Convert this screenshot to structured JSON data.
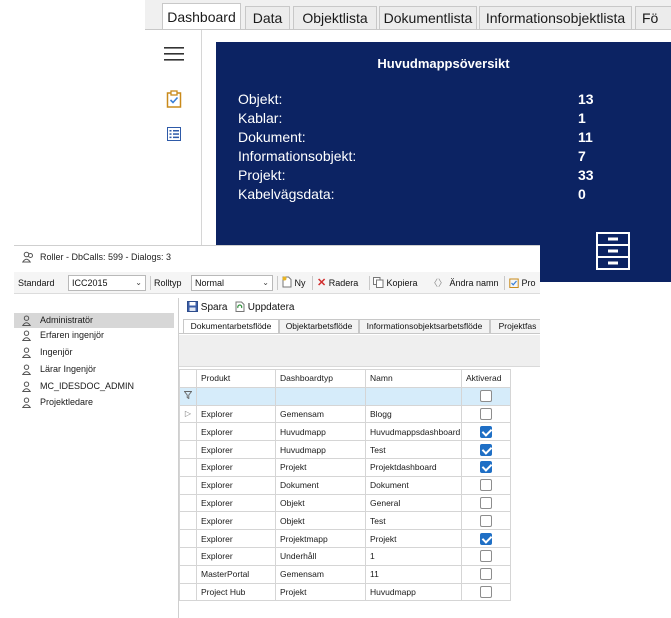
{
  "dashboard": {
    "tabs": [
      {
        "label": "Dashboard"
      },
      {
        "label": "Data"
      },
      {
        "label": "Objektlista"
      },
      {
        "label": "Dokumentlista"
      },
      {
        "label": "Informationsobjektlista"
      },
      {
        "label": "Fö"
      }
    ],
    "sidebar_icons": [
      "hamburger-menu-icon",
      "clipboard-check-icon",
      "list-icon"
    ],
    "panel_title": "Huvudmappsöversikt",
    "stats": [
      {
        "label": "Objekt:",
        "value": "13"
      },
      {
        "label": "Kablar:",
        "value": "1"
      },
      {
        "label": "Dokument:",
        "value": "11"
      },
      {
        "label": "Informationsobjekt:",
        "value": "7"
      },
      {
        "label": "Projekt:",
        "value": "33"
      },
      {
        "label": "Kabelvägsdata:",
        "value": "0"
      }
    ],
    "panel_icon": "cabinet-icon",
    "panel_color": "#0c2363"
  },
  "roller": {
    "title": "Roller - DbCalls: 599 - Dialogs: 3",
    "toolbar": {
      "standard_label": "Standard",
      "standard_value": "ICC2015",
      "rolltyp_label": "Rolltyp",
      "rolltyp_value": "Normal",
      "new_label": "Ny",
      "delete_label": "Radera",
      "copy_label": "Kopiera",
      "rename_label": "Ändra namn",
      "more_label": "Pro"
    },
    "roles": [
      {
        "label": "Administratör",
        "selected": true
      },
      {
        "label": "Erfaren ingenjör",
        "selected": false
      },
      {
        "label": "Ingenjör",
        "selected": false
      },
      {
        "label": "Lärar Ingenjör",
        "selected": false
      },
      {
        "label": "MC_IDESDOC_ADMIN",
        "selected": false
      },
      {
        "label": "Projektledare",
        "selected": false
      }
    ],
    "actions": {
      "save_label": "Spara",
      "refresh_label": "Uppdatera"
    },
    "subtabs": [
      {
        "label": "Dokumentarbetsflöde"
      },
      {
        "label": "Objektarbetsflöde"
      },
      {
        "label": "Informationsobjektsarbetsflöde"
      },
      {
        "label": "Projektfas"
      }
    ],
    "grid": {
      "columns": [
        "Produkt",
        "Dashboardtyp",
        "Namn",
        "Aktiverad"
      ],
      "rows": [
        {
          "produkt": "Explorer",
          "typ": "Gemensam",
          "namn": "Blogg",
          "aktiverad": false
        },
        {
          "produkt": "Explorer",
          "typ": "Huvudmapp",
          "namn": "Huvudmappsdashboard",
          "aktiverad": true
        },
        {
          "produkt": "Explorer",
          "typ": "Huvudmapp",
          "namn": "Test",
          "aktiverad": true
        },
        {
          "produkt": "Explorer",
          "typ": "Projekt",
          "namn": "Projektdashboard",
          "aktiverad": true
        },
        {
          "produkt": "Explorer",
          "typ": "Dokument",
          "namn": "Dokument",
          "aktiverad": false
        },
        {
          "produkt": "Explorer",
          "typ": "Objekt",
          "namn": "General",
          "aktiverad": false
        },
        {
          "produkt": "Explorer",
          "typ": "Objekt",
          "namn": "Test",
          "aktiverad": false
        },
        {
          "produkt": "Explorer",
          "typ": "Projektmapp",
          "namn": "Projekt",
          "aktiverad": true
        },
        {
          "produkt": "Explorer",
          "typ": "Underhåll",
          "namn": "1",
          "aktiverad": false
        },
        {
          "produkt": "MasterPortal",
          "typ": "Gemensam",
          "namn": "11",
          "aktiverad": false
        },
        {
          "produkt": "Project Hub",
          "typ": "Projekt",
          "namn": "Huvudmapp",
          "aktiverad": false
        }
      ]
    },
    "accent_color": "#1f6fc5"
  }
}
